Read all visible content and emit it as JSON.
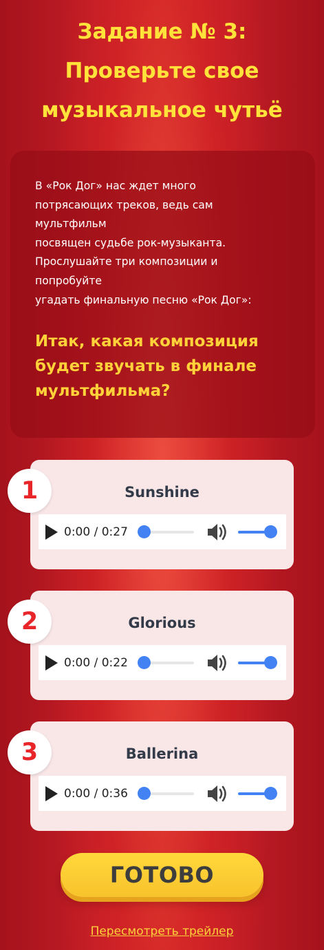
{
  "header": {
    "title_lines": [
      "Задание № 3:",
      "Проверьте свое",
      "музыкальное чутьё"
    ]
  },
  "info": {
    "text_lines": [
      "В «Рок Дог» нас ждет много",
      "потрясающих треков, ведь сам",
      "мультфильм",
      "посвящен судьбе рок-музыканта.",
      "Прослушайте три композиции и",
      "попробуйте",
      "угадать финальную песню «Рок Дог»:"
    ],
    "question_lines": [
      "Итак, какая композиция",
      "будет звучать в финале",
      "мультфильма?"
    ]
  },
  "tracks": [
    {
      "number": "1",
      "name": "Sunshine",
      "time": "0:00 / 0:27",
      "progress": 0,
      "volume": 1
    },
    {
      "number": "2",
      "name": "Glorious",
      "time": "0:00 / 0:22",
      "progress": 0,
      "volume": 1
    },
    {
      "number": "3",
      "name": "Ballerina",
      "time": "0:00 / 0:36",
      "progress": 0,
      "volume": 1
    }
  ],
  "player": {
    "play_icon": "play-icon",
    "volume_icon": "volume-icon"
  },
  "actions": {
    "done_label": "ГОТОВО",
    "trailer_link": "Пересмотреть трейлер"
  },
  "colors": {
    "background": "#c8202a",
    "title": "#ffe23a",
    "question": "#ffd23a",
    "card": "#f9e7e8",
    "number": "#e8262a",
    "player_accent": "#4282f3",
    "button": "#f8c32c"
  }
}
